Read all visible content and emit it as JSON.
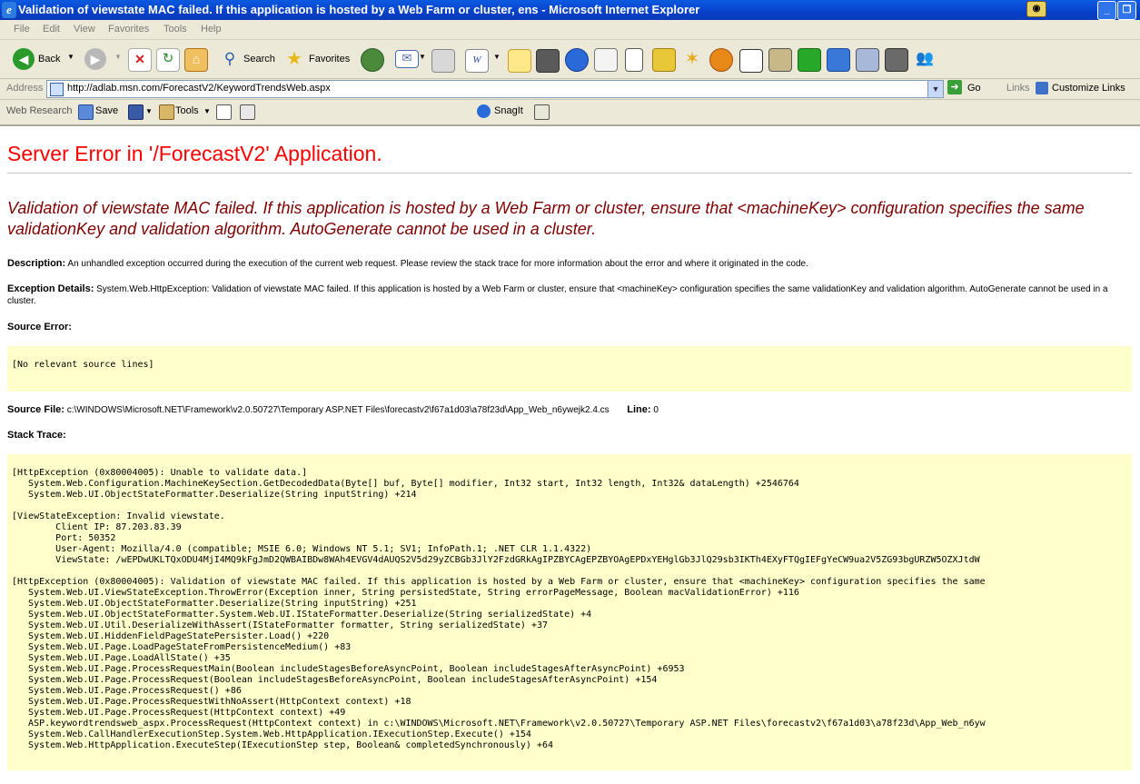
{
  "window": {
    "title": "Validation of viewstate MAC failed. If this application is hosted by a Web Farm or cluster, ens - Microsoft Internet Explorer",
    "minimize": "_",
    "restore": "❐"
  },
  "menu": [
    "File",
    "Edit",
    "View",
    "Favorites",
    "Tools",
    "Help"
  ],
  "toolbar": {
    "back": "Back",
    "search": "Search",
    "favorites": "Favorites"
  },
  "address": {
    "label": "Address",
    "url": "http://adlab.msn.com/ForecastV2/KeywordTrendsWeb.aspx",
    "go": "Go",
    "links": "Links",
    "customize": "Customize Links"
  },
  "research": {
    "web_research": "Web Research",
    "save": "Save",
    "tools": "Tools",
    "snagit": "SnagIt"
  },
  "error": {
    "heading": "Server Error in '/ForecastV2' Application.",
    "message": "Validation of viewstate MAC failed. If this application is hosted by a Web Farm or cluster, ensure that <machineKey> configuration specifies the same validationKey and validation algorithm. AutoGenerate cannot be used in a cluster.",
    "description_label": "Description:",
    "description": "An unhandled exception occurred during the execution of the current web request. Please review the stack trace for more information about the error and where it originated in the code.",
    "exception_label": "Exception Details:",
    "exception": "System.Web.HttpException: Validation of viewstate MAC failed. If this application is hosted by a Web Farm or cluster, ensure that <machineKey> configuration specifies the same validationKey and validation algorithm. AutoGenerate cannot be used in a cluster.",
    "source_error_label": "Source Error:",
    "source_error": "[No relevant source lines]",
    "source_file_label": "Source File:",
    "source_file": "c:\\WINDOWS\\Microsoft.NET\\Framework\\v2.0.50727\\Temporary ASP.NET Files\\forecastv2\\f67a1d03\\a78f23d\\App_Web_n6ywejk2.4.cs",
    "line_label": "Line:",
    "line": "0",
    "stack_trace_label": "Stack Trace:",
    "stack_trace": "[HttpException (0x80004005): Unable to validate data.]\n   System.Web.Configuration.MachineKeySection.GetDecodedData(Byte[] buf, Byte[] modifier, Int32 start, Int32 length, Int32& dataLength) +2546764\n   System.Web.UI.ObjectStateFormatter.Deserialize(String inputString) +214\n\n[ViewStateException: Invalid viewstate.\n\tClient IP: 87.203.83.39\n\tPort: 50352\n\tUser-Agent: Mozilla/4.0 (compatible; MSIE 6.0; Windows NT 5.1; SV1; InfoPath.1; .NET CLR 1.1.4322)\n\tViewState: /wEPDwUKLTQxODU4MjI4MQ9kFgJmD2QWBAIBDw8WAh4EVGV4dAUQS2V5d29yZCBGb3JlY2FzdGRkAgIPZBYCAgEPZBYOAgEPDxYEHglGb3JlQ29sb3IKTh4EXyFTQgIEFgYeCW9ua2V5ZG93bgURZW5OZXJtdW\n\n[HttpException (0x80004005): Validation of viewstate MAC failed. If this application is hosted by a Web Farm or cluster, ensure that <machineKey> configuration specifies the same\n   System.Web.UI.ViewStateException.ThrowError(Exception inner, String persistedState, String errorPageMessage, Boolean macValidationError) +116\n   System.Web.UI.ObjectStateFormatter.Deserialize(String inputString) +251\n   System.Web.UI.ObjectStateFormatter.System.Web.UI.IStateFormatter.Deserialize(String serializedState) +4\n   System.Web.UI.Util.DeserializeWithAssert(IStateFormatter formatter, String serializedState) +37\n   System.Web.UI.HiddenFieldPageStatePersister.Load() +220\n   System.Web.UI.Page.LoadPageStateFromPersistenceMedium() +83\n   System.Web.UI.Page.LoadAllState() +35\n   System.Web.UI.Page.ProcessRequestMain(Boolean includeStagesBeforeAsyncPoint, Boolean includeStagesAfterAsyncPoint) +6953\n   System.Web.UI.Page.ProcessRequest(Boolean includeStagesBeforeAsyncPoint, Boolean includeStagesAfterAsyncPoint) +154\n   System.Web.UI.Page.ProcessRequest() +86\n   System.Web.UI.Page.ProcessRequestWithNoAssert(HttpContext context) +18\n   System.Web.UI.Page.ProcessRequest(HttpContext context) +49\n   ASP.keywordtrendsweb_aspx.ProcessRequest(HttpContext context) in c:\\WINDOWS\\Microsoft.NET\\Framework\\v2.0.50727\\Temporary ASP.NET Files\\forecastv2\\f67a1d03\\a78f23d\\App_Web_n6yw\n   System.Web.CallHandlerExecutionStep.System.Web.HttpApplication.IExecutionStep.Execute() +154\n   System.Web.HttpApplication.ExecuteStep(IExecutionStep step, Boolean& completedSynchronously) +64"
  }
}
